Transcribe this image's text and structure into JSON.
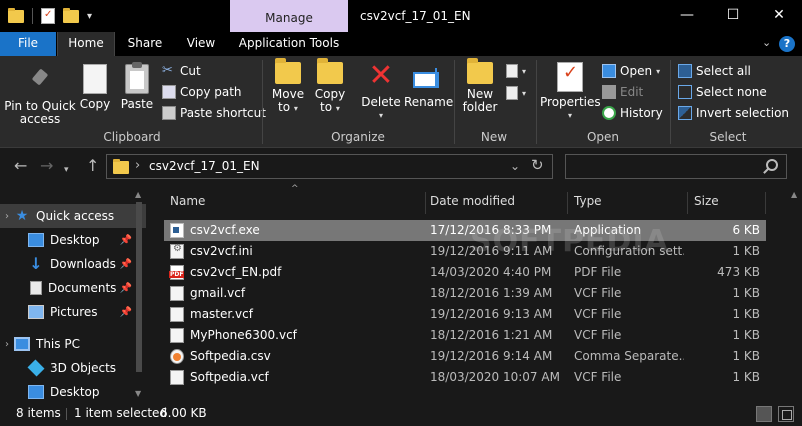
{
  "window": {
    "title": "csv2vcf_17_01_EN",
    "context_tab": "Manage",
    "controls": {
      "minimize": "—",
      "maximize": "☐",
      "close": "✕"
    }
  },
  "qat": {
    "dropdown": "▾"
  },
  "tabs": {
    "file": "File",
    "home": "Home",
    "share": "Share",
    "view": "View",
    "application_tools": "Application Tools",
    "expand_ribbon": "⌄",
    "help": "?"
  },
  "ribbon": {
    "clipboard": {
      "label": "Clipboard",
      "pin_to_quick_access_line1": "Pin to Quick",
      "pin_to_quick_access_line2": "access",
      "copy": "Copy",
      "paste": "Paste",
      "cut": "Cut",
      "copy_path": "Copy path",
      "paste_shortcut": "Paste shortcut"
    },
    "organize": {
      "label": "Organize",
      "move_to_line1": "Move",
      "move_to_line2": "to",
      "copy_to_line1": "Copy",
      "copy_to_line2": "to",
      "delete": "Delete",
      "rename": "Rename"
    },
    "new": {
      "label": "New",
      "new_folder_line1": "New",
      "new_folder_line2": "folder"
    },
    "open": {
      "label": "Open",
      "properties": "Properties",
      "open": "Open",
      "edit": "Edit",
      "history": "History"
    },
    "select": {
      "label": "Select",
      "select_all": "Select all",
      "select_none": "Select none",
      "invert_selection": "Invert selection"
    }
  },
  "address": {
    "path": "csv2vcf_17_01_EN",
    "search_placeholder": ""
  },
  "nav_pane": {
    "items": [
      {
        "label": "Quick access",
        "icon": "star-icon",
        "selected": true
      },
      {
        "label": "Desktop",
        "icon": "desktop-icon",
        "pinned": true
      },
      {
        "label": "Downloads",
        "icon": "downloads-icon",
        "pinned": true
      },
      {
        "label": "Documents",
        "icon": "documents-icon",
        "pinned": true
      },
      {
        "label": "Pictures",
        "icon": "pictures-icon",
        "pinned": true
      },
      {
        "label": "This PC",
        "icon": "pc-icon"
      },
      {
        "label": "3D Objects",
        "icon": "3d-objects-icon"
      },
      {
        "label": "Desktop",
        "icon": "desktop-icon"
      }
    ]
  },
  "columns": {
    "name": "Name",
    "date": "Date modified",
    "type": "Type",
    "size": "Size"
  },
  "files": [
    {
      "name": "csv2vcf.exe",
      "date": "17/12/2016 8:33 PM",
      "type": "Application",
      "size": "6 KB",
      "icon": "exe-icon",
      "selected": true
    },
    {
      "name": "csv2vcf.ini",
      "date": "19/12/2016 9:11 AM",
      "type": "Configuration sett...",
      "size": "1 KB",
      "icon": "ini-icon"
    },
    {
      "name": "csv2vcf_EN.pdf",
      "date": "14/03/2020 4:40 PM",
      "type": "PDF File",
      "size": "473 KB",
      "icon": "pdf-icon"
    },
    {
      "name": "gmail.vcf",
      "date": "18/12/2016 1:39 AM",
      "type": "VCF File",
      "size": "1 KB",
      "icon": "vcf-icon"
    },
    {
      "name": "master.vcf",
      "date": "19/12/2016 9:13 AM",
      "type": "VCF File",
      "size": "1 KB",
      "icon": "vcf-icon"
    },
    {
      "name": "MyPhone6300.vcf",
      "date": "18/12/2016 1:21 AM",
      "type": "VCF File",
      "size": "1 KB",
      "icon": "vcf-icon"
    },
    {
      "name": "Softpedia.csv",
      "date": "19/12/2016 9:14 AM",
      "type": "Comma Separate...",
      "size": "1 KB",
      "icon": "csv-icon"
    },
    {
      "name": "Softpedia.vcf",
      "date": "18/03/2020 10:07 AM",
      "type": "VCF File",
      "size": "1 KB",
      "icon": "vcf-icon"
    }
  ],
  "watermark": "SOFTPEDIA",
  "status": {
    "item_count": "8 items",
    "selection": "1 item selected",
    "selection_size": "6.00 KB"
  },
  "colors": {
    "accent": "#1a73c8",
    "manage_tab": "#dac9f0",
    "background": "#191919",
    "ribbon": "#2b2b2b",
    "selection": "#777777"
  }
}
